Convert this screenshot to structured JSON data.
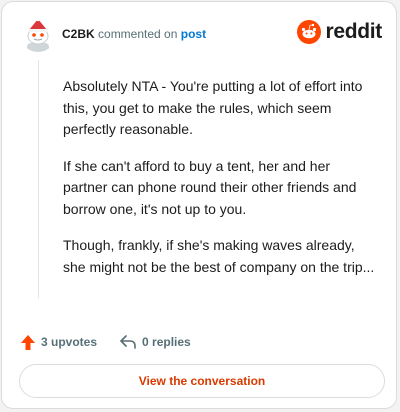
{
  "comment": {
    "username": "C2BK",
    "action_text": "commented on",
    "post_link": "post",
    "paragraphs": [
      "Absolutely NTA - You're putting a lot of effort into this, you get to make the rules, which seem perfectly reasonable.",
      "If she can't afford to buy a tent, her and her partner can phone round their other friends and borrow one, it's not up to you.",
      "Though, frankly, if she's making waves already, she might not be the best of company on the trip..."
    ]
  },
  "brand": {
    "wordmark": "reddit",
    "color": "#ff4500"
  },
  "actions": {
    "upvotes": "3 upvotes",
    "replies": "0 replies",
    "upvote_color": "#ff4500"
  },
  "cta": {
    "label": "View the conversation",
    "color": "#d93a00"
  },
  "icons": [
    "avatar-snoo",
    "reddit-logo-icon",
    "upvote-arrow-icon",
    "reply-arrow-icon"
  ]
}
